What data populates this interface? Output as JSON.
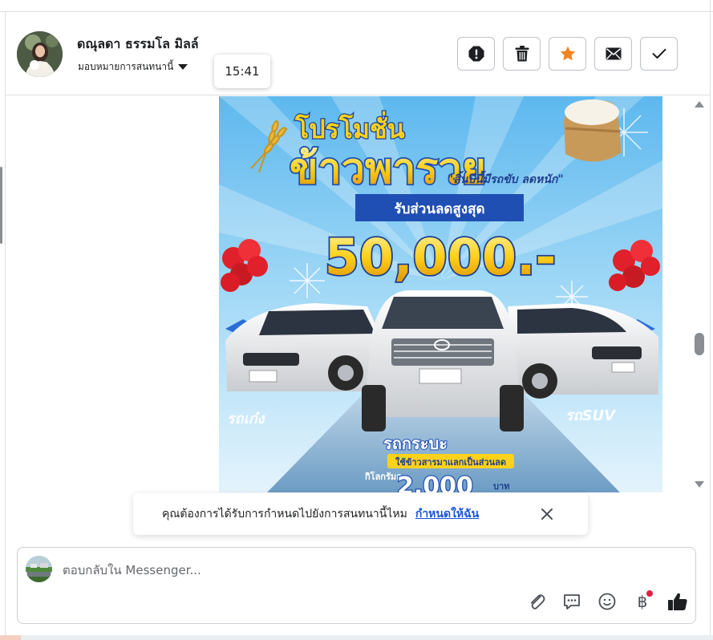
{
  "header": {
    "name": "ดณุลดา ธรรมโล มิลล์",
    "assign_label": "มอบหมายการสนทนานี้",
    "tooltip_time": "15:41",
    "actions": [
      {
        "icon": "alert-icon"
      },
      {
        "icon": "trash-icon"
      },
      {
        "icon": "star-icon",
        "color": "#f5821f"
      },
      {
        "icon": "mail-icon"
      },
      {
        "icon": "check-icon"
      }
    ]
  },
  "promo": {
    "line1": "โปรโมชั่น",
    "line2": "ข้าวพารวย",
    "tagline": "\"สิ้นปีนี้มีรถขับ ลดหนัก\"",
    "discount_label": "รับส่วนลดสูงสุด",
    "discount_value": "50,000.-",
    "car_left": "รถเก๋ง",
    "car_right": "รถSUV",
    "car_center": "รถกระบะ",
    "rice_offer": "ใช้ข้าวสารมาแลกเป็นส่วนลด",
    "per_kg": "กิโลกรัมละ",
    "per_kg_value": "2,000",
    "currency_unit": "บาท"
  },
  "banner": {
    "text": "คุณต้องการได้รับการกำหนดไปยังการสนทนานี้ไหม",
    "link": "กำหนดให้ฉัน"
  },
  "composer": {
    "placeholder": "ตอบกลับใน Messenger...",
    "tools": [
      "attach-icon",
      "saved-reply-icon",
      "emoji-icon",
      "baht-icon",
      "like-icon"
    ],
    "baht_symbol": "฿"
  },
  "colors": {
    "accent_star": "#f5821f",
    "link": "#1a56d6",
    "promo_yellow": "#ffd21a",
    "promo_blue": "#1f4fb3"
  }
}
